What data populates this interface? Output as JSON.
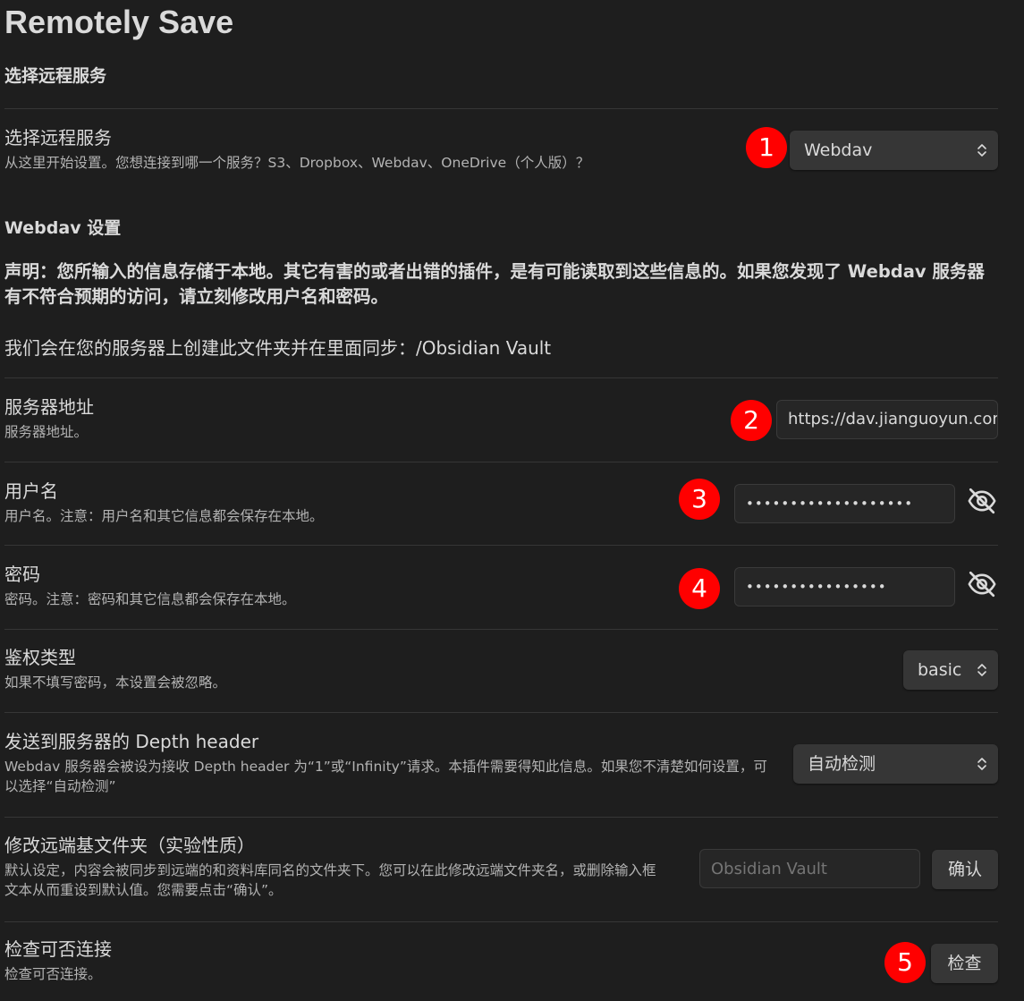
{
  "plugin_title": "Remotely Save",
  "section_choose_service": {
    "heading": "选择远程服务",
    "setting_name": "选择远程服务",
    "setting_desc": "从这里开始设置。您想连接到哪一个服务？S3、Dropbox、Webdav、OneDrive（个人版）？",
    "selected_value": "Webdav",
    "badge": "1"
  },
  "webdav": {
    "heading": "Webdav 设置",
    "notice": "声明：您所输入的信息存储于本地。其它有害的或者出错的插件，是有可能读取到这些信息的。如果您发现了 Webdav 服务器有不符合预期的访问，请立刻修改用户名和密码。",
    "folder_info": "我们会在您的服务器上创建此文件夹并在里面同步：/Obsidian Vault",
    "server_address": {
      "name": "服务器地址",
      "desc": "服务器地址。",
      "value": "https://dav.jianguoyun.com",
      "badge": "2"
    },
    "username": {
      "name": "用户名",
      "desc": "用户名。注意：用户名和其它信息都会保存在本地。",
      "value": "•••••••••••••••••••",
      "badge": "3",
      "toggle_icon": "eye-off-icon"
    },
    "password": {
      "name": "密码",
      "desc": "密码。注意：密码和其它信息都会保存在本地。",
      "value": "••••••••••••••••",
      "badge": "4",
      "toggle_icon": "eye-off-icon"
    },
    "auth_type": {
      "name": "鉴权类型",
      "desc": "如果不填写密码，本设置会被忽略。",
      "selected_value": "basic"
    },
    "depth_header": {
      "name": "发送到服务器的 Depth header",
      "desc": "Webdav 服务器会被设为接收 Depth header 为“1”或“Infinity”请求。本插件需要得知此信息。如果您不清楚如何设置，可以选择“自动检测”",
      "selected_value": "自动检测"
    },
    "remote_base_dir": {
      "name": "修改远端基文件夹（实验性质）",
      "desc": "默认设定，内容会被同步到远端的和资料库同名的文件夹下。您可以在此修改远端文件夹名，或删除输入框文本从而重设到默认值。您需要点击“确认”。",
      "placeholder": "Obsidian Vault",
      "confirm_label": "确认"
    },
    "check_connection": {
      "name": "检查可否连接",
      "desc": "检查可否连接。",
      "button_label": "检查",
      "badge": "5"
    }
  },
  "colors": {
    "background": "#1e1e1e",
    "badge": "#ff0000",
    "control": "#363636",
    "text": "#dadada",
    "muted_text": "#b3b3b3"
  }
}
